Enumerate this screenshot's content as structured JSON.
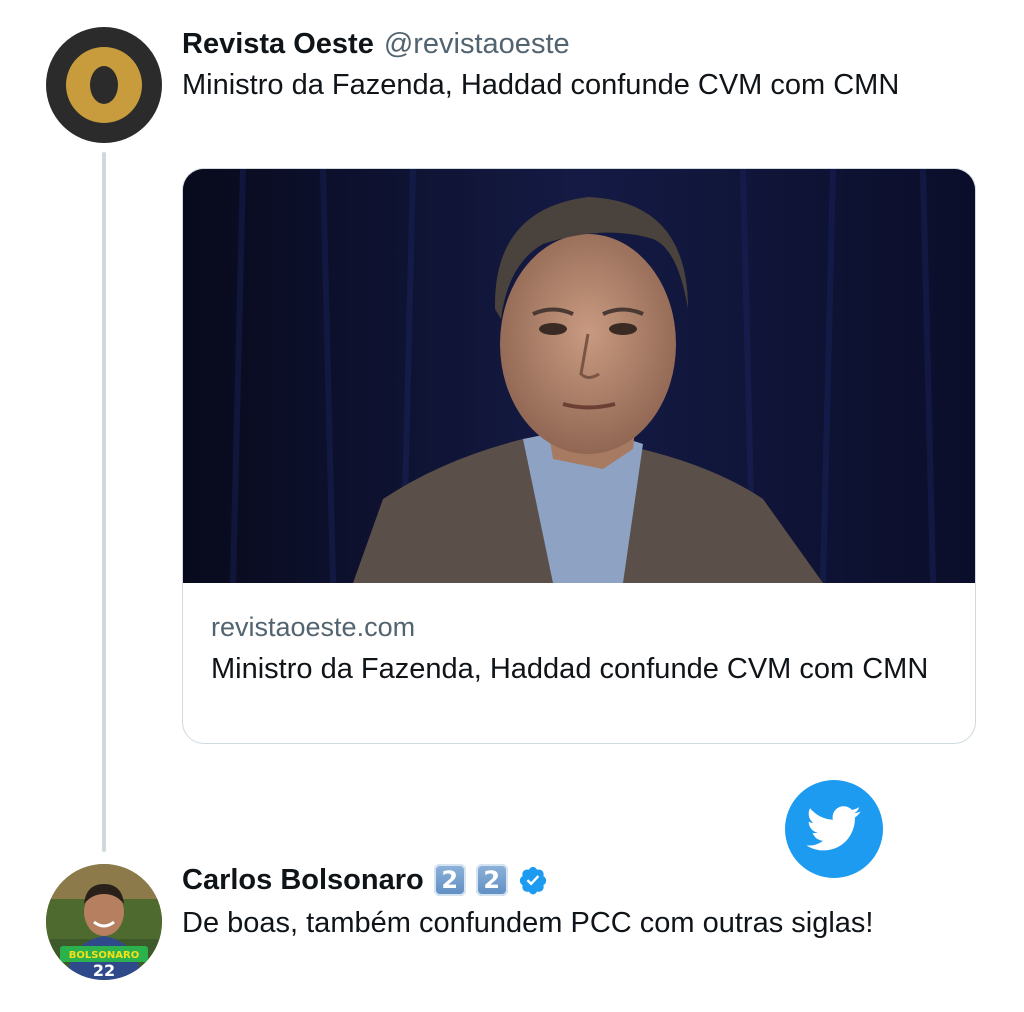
{
  "tweets": [
    {
      "display_name": "Revista Oeste",
      "handle": "@revistaoeste",
      "text": "Ministro da Fazenda, Haddad confunde CVM com CMN",
      "card": {
        "domain": "revistaoeste.com",
        "title": "Ministro da Fazenda, Haddad confunde CVM com CMN"
      }
    },
    {
      "display_name": "Carlos Bolsonaro",
      "name_emojis": [
        "2",
        "2"
      ],
      "verified": true,
      "text": "De boas, também confundem PCC com outras siglas!",
      "avatar_badge": {
        "line1": "BOLSONARO",
        "line2": "22"
      }
    }
  ],
  "icons": {
    "brand": "twitter-bird-icon",
    "verified": "verified-badge-icon"
  },
  "colors": {
    "twitter_blue": "#1d9bf0",
    "oeste_gold": "#c89b3c",
    "text_primary": "#0f1419",
    "text_secondary": "#536471"
  }
}
